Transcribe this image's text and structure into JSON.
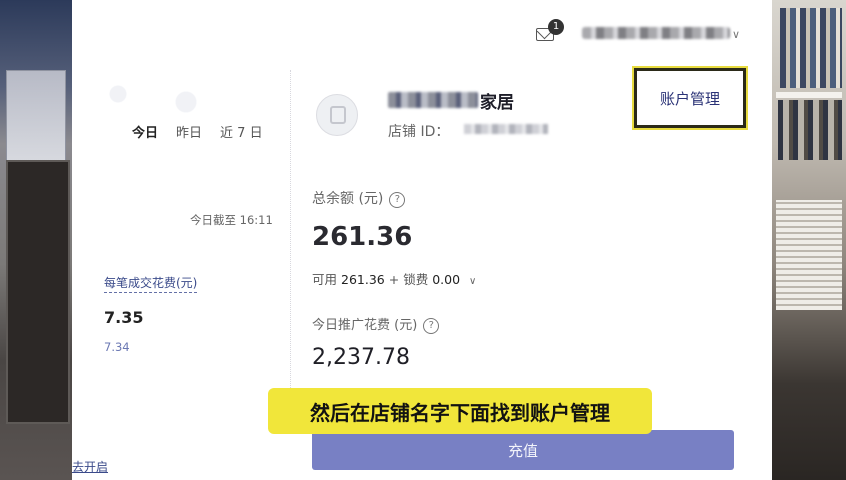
{
  "topbar": {
    "mail_icon": "mail-icon",
    "mail_badge": "1",
    "user_caret": "∨"
  },
  "sidebar": {
    "date_tabs": [
      "今日",
      "昨日",
      "近 7 日"
    ],
    "active_tab": "今日",
    "as_of": "今日截至 16:11",
    "metric_label": "每笔成交花费(元)",
    "metric_value": "7.35",
    "metric_prev": "7.34",
    "go_open_link": "去开启"
  },
  "store": {
    "name_suffix": "家居",
    "id_label": "店铺 ID："
  },
  "header": {
    "account_management": "账户管理"
  },
  "balance": {
    "label": "总余额 (元)",
    "value": "261.36",
    "available_label": "可用",
    "available_value": "261.36",
    "plus": "+",
    "frozen_label": "锁费",
    "frozen_value": "0.00",
    "today_spend_label": "今日推广花费 (元)",
    "today_spend_value": "2,237.78"
  },
  "actions": {
    "recharge": "充值"
  },
  "caption": {
    "text": "然后在店铺名字下面找到账户管理"
  },
  "colors": {
    "accent": "#7880c4",
    "caption_bg": "#f1e63a",
    "link": "#3a4a8a"
  }
}
